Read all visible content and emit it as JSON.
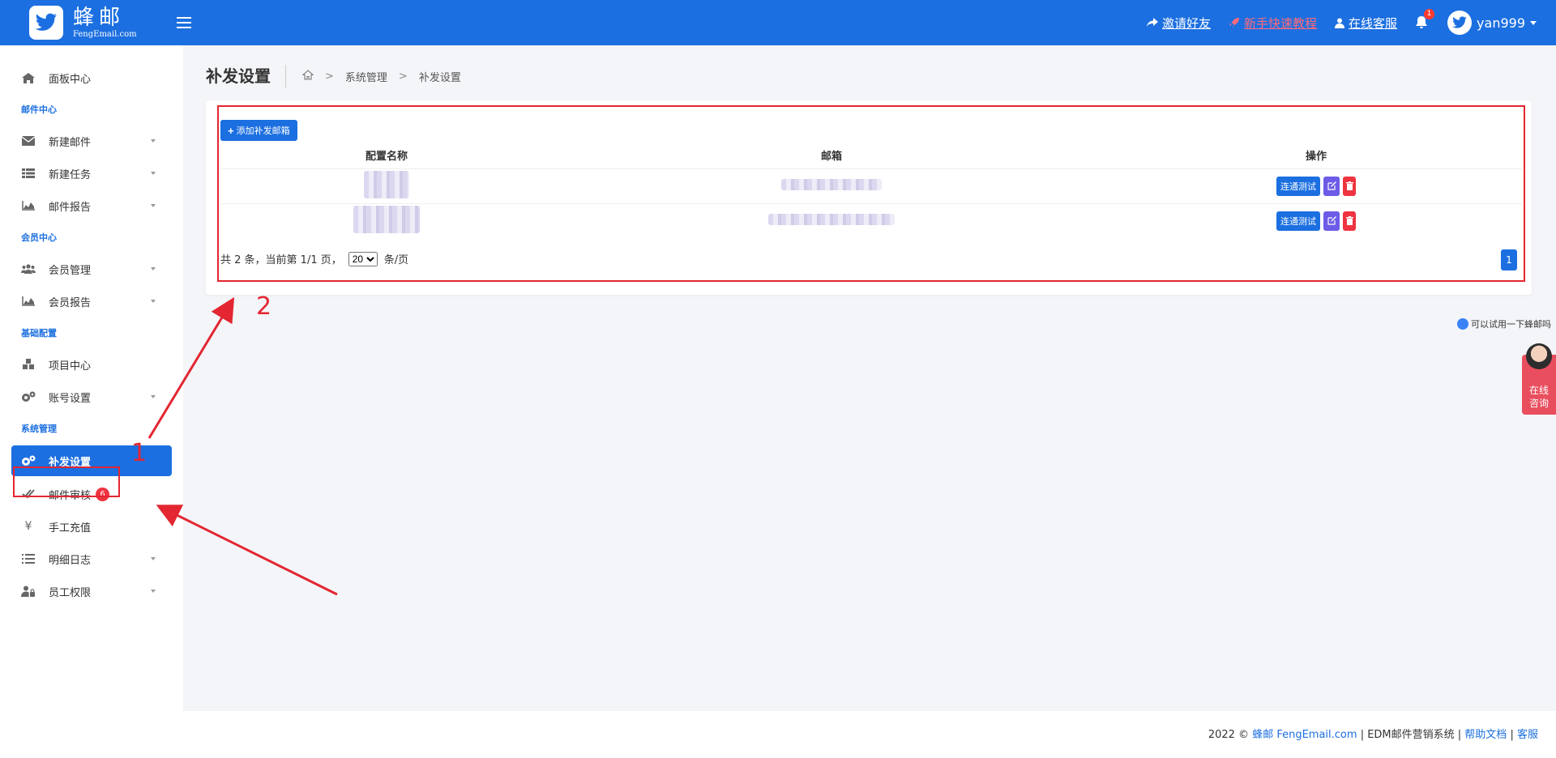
{
  "brand": {
    "name_cn": "蜂邮",
    "name_en": "FengEmail.com"
  },
  "topbar": {
    "invite": "邀请好友",
    "tutorial": "新手快速教程",
    "support": "在线客服",
    "notifications": "1",
    "username": "yan999"
  },
  "sidebar": {
    "dashboard": "面板中心",
    "section_mail": "邮件中心",
    "new_mail": "新建邮件",
    "new_task": "新建任务",
    "mail_report": "邮件报告",
    "section_member": "会员中心",
    "member_manage": "会员管理",
    "member_report": "会员报告",
    "section_basic": "基础配置",
    "project_center": "项目中心",
    "account_settings": "账号设置",
    "section_system": "系统管理",
    "resend_settings": "补发设置",
    "mail_review": "邮件审核",
    "mail_review_badge": "6",
    "manual_recharge": "手工充值",
    "detail_log": "明细日志",
    "staff_permissions": "员工权限"
  },
  "page": {
    "title": "补发设置",
    "breadcrumb": [
      "系统管理",
      "补发设置"
    ]
  },
  "table": {
    "add_button": "添加补发邮箱",
    "headers": {
      "name": "配置名称",
      "email": "邮箱",
      "actions": "操作"
    },
    "test_label": "连通测试",
    "rows": [
      {},
      {}
    ]
  },
  "pagination": {
    "summary": "共 2 条，当前第 1/1 页，",
    "per_page": "20",
    "per_page_unit": "条/页",
    "current": "1"
  },
  "annotations": {
    "label1": "1",
    "label2": "2"
  },
  "float": {
    "tip": "可以试用一下蜂邮吗",
    "consult": "在线咨询"
  },
  "footer": {
    "year": "2022 ©",
    "brand": "蜂邮 FengEmail.com",
    "system": "| EDM邮件营销系统 |",
    "help": "帮助文档",
    "sep": "|",
    "service": "客服"
  },
  "colors": {
    "primary": "#1c6fe0",
    "danger": "#ef3340",
    "annotation": "#e32631"
  }
}
